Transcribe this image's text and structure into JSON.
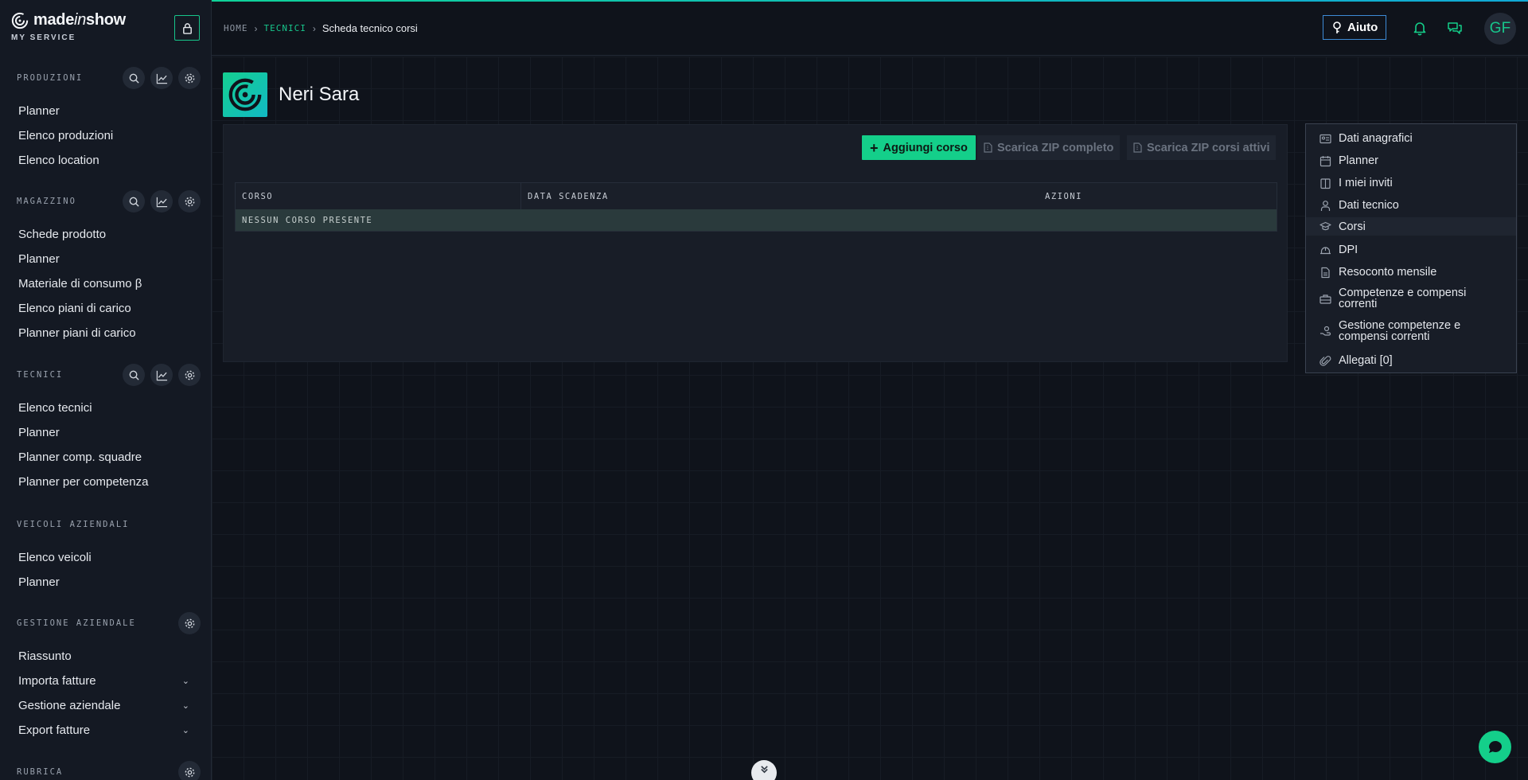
{
  "brand": {
    "name_prefix": "made",
    "name_italic": "in",
    "name_suffix": "show",
    "subtitle": "MY SERVICE"
  },
  "sidebar": {
    "sections": [
      {
        "title": "PRODUZIONI",
        "icons": [
          "search-icon",
          "chart-icon",
          "gear-icon"
        ],
        "items": [
          {
            "label": "Planner"
          },
          {
            "label": "Elenco produzioni"
          },
          {
            "label": "Elenco location"
          }
        ]
      },
      {
        "title": "MAGAZZINO",
        "icons": [
          "search-icon",
          "chart-icon",
          "gear-icon"
        ],
        "items": [
          {
            "label": "Schede prodotto"
          },
          {
            "label": "Planner"
          },
          {
            "label": "Materiale di consumo β"
          },
          {
            "label": "Elenco piani di carico"
          },
          {
            "label": "Planner piani di carico"
          }
        ]
      },
      {
        "title": "TECNICI",
        "icons": [
          "search-icon",
          "chart-icon",
          "gear-icon"
        ],
        "items": [
          {
            "label": "Elenco tecnici"
          },
          {
            "label": "Planner"
          },
          {
            "label": "Planner comp. squadre"
          },
          {
            "label": "Planner per competenza"
          }
        ]
      },
      {
        "title": "VEICOLI AZIENDALI",
        "icons": [],
        "items": [
          {
            "label": "Elenco veicoli"
          },
          {
            "label": "Planner"
          }
        ]
      },
      {
        "title": "GESTIONE AZIENDALE",
        "icons": [
          "gear-icon"
        ],
        "items": [
          {
            "label": "Riassunto"
          },
          {
            "label": "Importa fatture",
            "expandable": true
          },
          {
            "label": "Gestione aziendale",
            "expandable": true
          },
          {
            "label": "Export fatture",
            "expandable": true
          }
        ]
      },
      {
        "title": "RUBRICA",
        "icons": [
          "gear-icon"
        ],
        "items": []
      }
    ]
  },
  "breadcrumb": {
    "home": "HOME",
    "section": "TECNICI",
    "current": "Scheda tecnico corsi"
  },
  "header": {
    "help_label": "Aiuto",
    "avatar_initials": "GF"
  },
  "profile": {
    "name": "Neri Sara"
  },
  "toolbar": {
    "add_label": "Aggiungi corso",
    "zip_all_label": "Scarica ZIP completo",
    "zip_active_label": "Scarica ZIP corsi attivi"
  },
  "table": {
    "columns": [
      "CORSO",
      "DATA SCADENZA",
      "AZIONI"
    ],
    "empty_message": "NESSUN CORSO PRESENTE"
  },
  "side_menu": {
    "items": [
      {
        "label": "Dati anagrafici",
        "icon": "id-card-icon"
      },
      {
        "label": "Planner",
        "icon": "calendar-icon"
      },
      {
        "label": "I miei inviti",
        "icon": "invite-icon"
      },
      {
        "label": "Dati tecnico",
        "icon": "user-icon"
      },
      {
        "label": "Corsi",
        "icon": "graduation-cap-icon",
        "active": true
      },
      {
        "label": "DPI",
        "icon": "helmet-icon"
      },
      {
        "label": "Resoconto mensile",
        "icon": "report-icon"
      },
      {
        "label": "Competenze e compensi correnti",
        "icon": "toolbox-icon"
      },
      {
        "label": "Gestione competenze e compensi correnti",
        "icon": "hand-coin-icon"
      },
      {
        "label": "Allegati [0]",
        "icon": "paperclip-icon"
      }
    ]
  },
  "colors": {
    "accent": "#14cf8a",
    "background": "#0f131b",
    "sidebar": "#141923",
    "help_border": "#3d8bd6"
  }
}
